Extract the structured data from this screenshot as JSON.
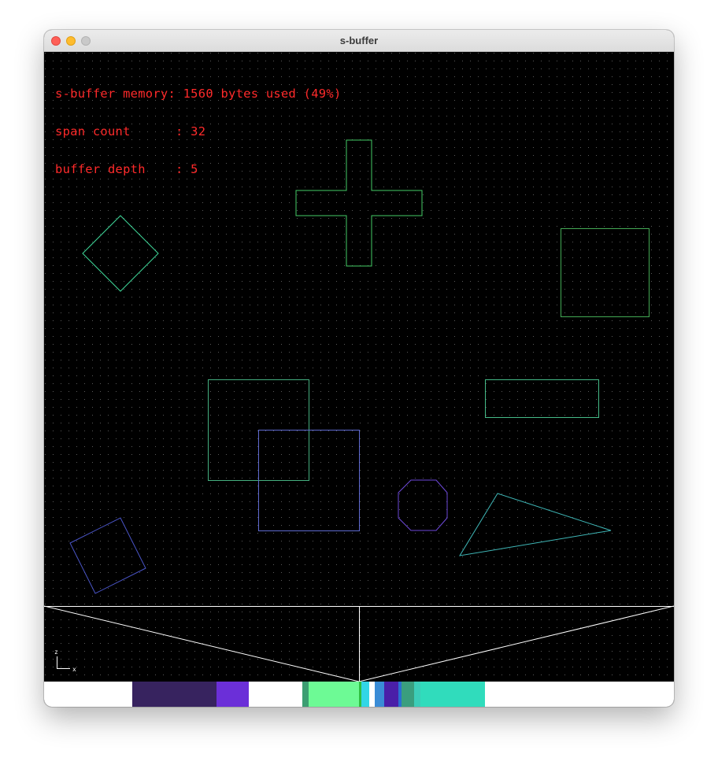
{
  "window": {
    "title": "s-buffer"
  },
  "stats": {
    "memory": "s-buffer memory: 1560 bytes used (49%)",
    "span_count": "span count      : 32",
    "buffer_depth": "buffer depth    : 5"
  },
  "axis": {
    "z": "z",
    "x": "x"
  },
  "colors": {
    "stats_text": "#ff2a2a",
    "grid_dot": "#5a5a5a",
    "view_lines": "#ffffff",
    "buffer_bg": "#ffffff"
  },
  "shapes": [
    {
      "name": "diamond",
      "stroke": "#3fd89a"
    },
    {
      "name": "plus-cross",
      "stroke": "#44cc66"
    },
    {
      "name": "square-right",
      "stroke": "#44aa55"
    },
    {
      "name": "square-overlap-a",
      "stroke": "#45b080"
    },
    {
      "name": "square-overlap-b",
      "stroke": "#5f6ad0"
    },
    {
      "name": "wide-rectangle",
      "stroke": "#45bb88"
    },
    {
      "name": "octagon",
      "stroke": "#6d49d8"
    },
    {
      "name": "triangle",
      "stroke": "#3fb8b8"
    },
    {
      "name": "tilted-square",
      "stroke": "#4a55c8"
    }
  ],
  "depth_buffer_spans": [
    {
      "color": "#37235f"
    },
    {
      "color": "#6b2fd8"
    },
    {
      "color": "#3c9e72"
    },
    {
      "color": "#6dfa95"
    },
    {
      "color": "#2fbf40"
    },
    {
      "color": "#33d6e6"
    },
    {
      "color": "#3a8cd6"
    },
    {
      "color": "#4a1fa8"
    },
    {
      "color": "#2a6fd1"
    },
    {
      "color": "#3a9e7e"
    },
    {
      "color": "#3ccdb8"
    },
    {
      "color": "#30dcbc"
    }
  ]
}
